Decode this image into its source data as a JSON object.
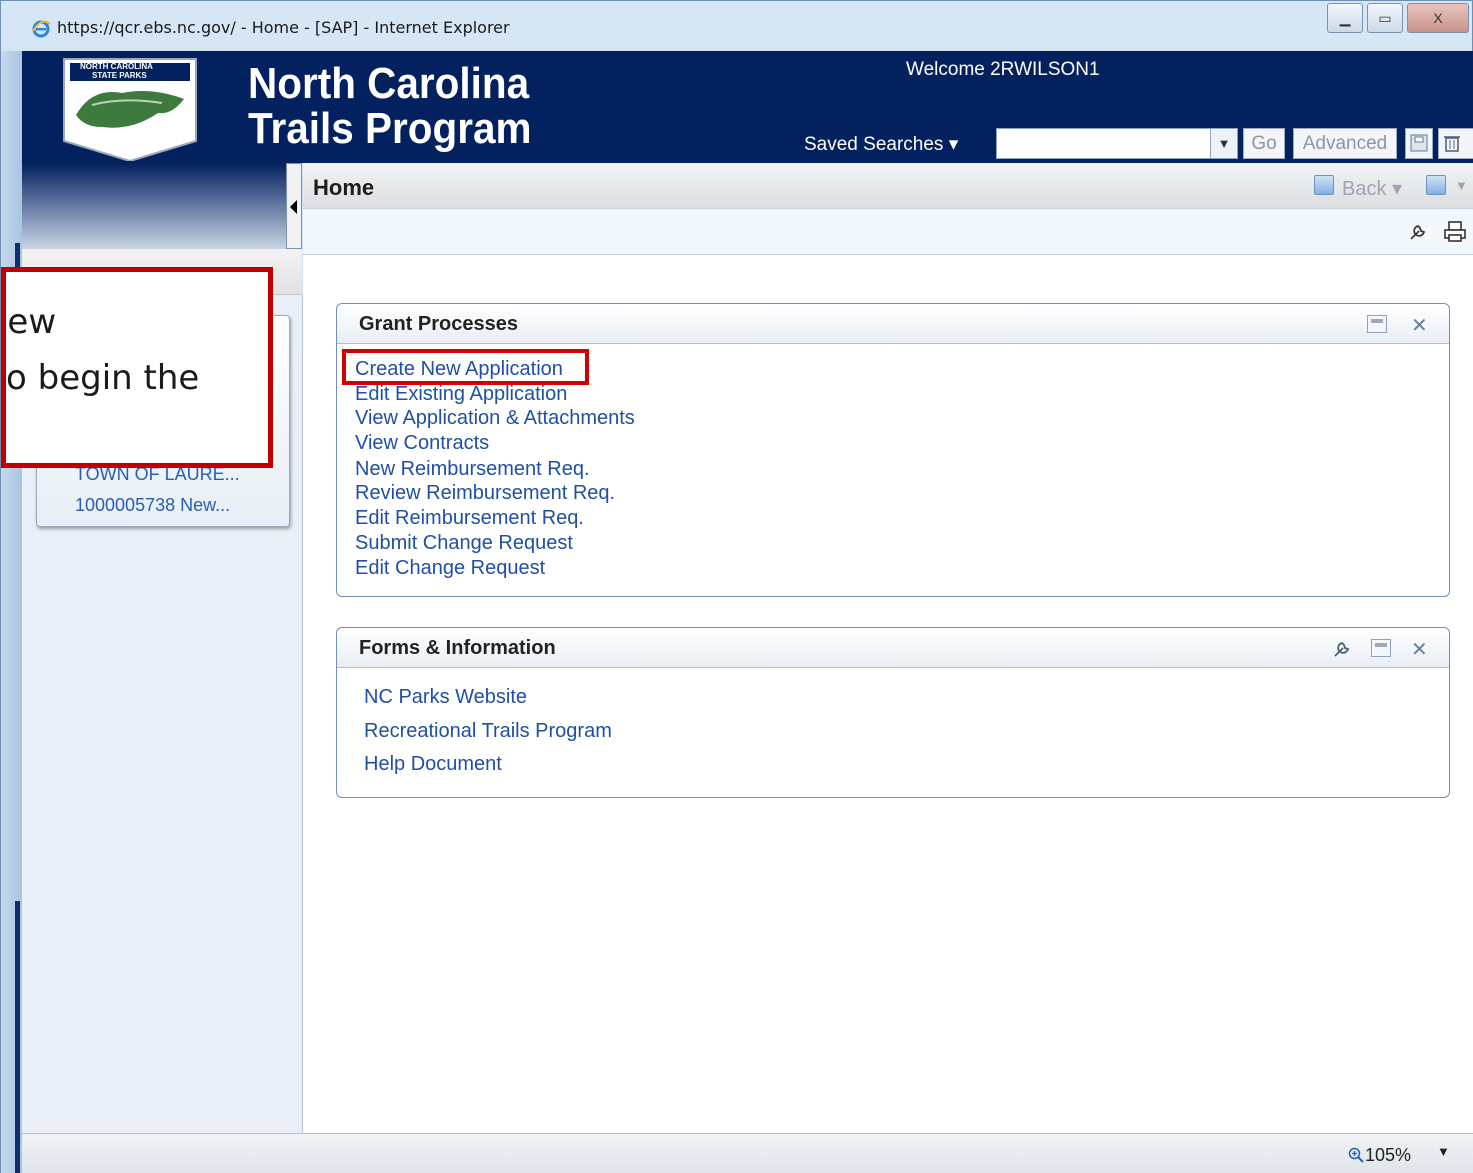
{
  "browser": {
    "title": "https://qcr.ebs.nc.gov/ - Home - [SAP] - Internet Explorer",
    "controls": {
      "minimize": "▁",
      "maximize": "▭",
      "close": "X"
    },
    "zoom": "105%"
  },
  "header": {
    "brand_line1": "North Carolina",
    "brand_line2": "Trails Program",
    "logo_text_top": "NORTH CAROLINA",
    "logo_text_bottom": "STATE PARKS",
    "welcome": "Welcome 2RWILSON1",
    "saved_searches": "Saved Searches ▾",
    "search_value": "",
    "go_label": "Go",
    "advanced_label": "Advanced"
  },
  "breadcrumb": {
    "title": "Home",
    "back_label": "Back ▾"
  },
  "sidebar": {
    "recent_items": [
      "TOWN OF LAURE...",
      "1000005738 New..."
    ]
  },
  "grant_panel": {
    "title": "Grant Processes",
    "links": [
      "Create New Application",
      "Edit Existing Application",
      "View Application & Attachments",
      "View Contracts",
      "New Reimbursement Req.",
      "Review Reimbursement Req.",
      "Edit Reimbursement Req.",
      "Submit Change Request",
      "Edit Change Request"
    ]
  },
  "forms_panel": {
    "title": "Forms & Information",
    "links": [
      "NC Parks Website",
      "Recreational Trails Program",
      "Help Document"
    ]
  },
  "callout": {
    "text": "New\no begin the"
  },
  "colors": {
    "header_navy": "#03205f",
    "link_blue": "#1f4fa6",
    "highlight_red": "#d40000"
  }
}
